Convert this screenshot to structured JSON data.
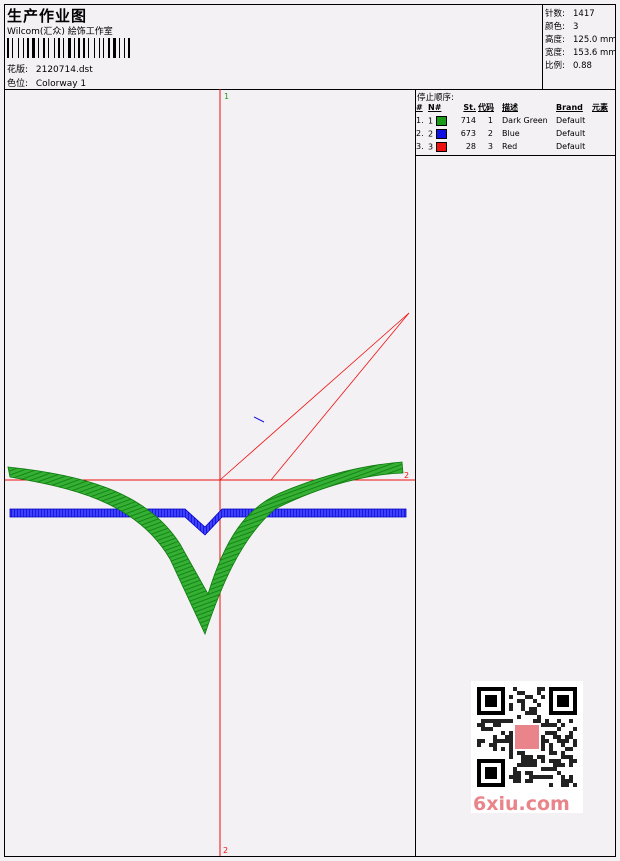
{
  "header": {
    "title": "生产作业图",
    "company": "Wilcom(汇众) 絵饰工作室",
    "design_label": "花版:",
    "design_value": "2120714.dst",
    "colorway_label": "色位:",
    "colorway_value": "Colorway 1"
  },
  "stats": {
    "stitches_label": "针数:",
    "stitches_value": "1417",
    "colors_label": "颜色:",
    "colors_value": "3",
    "height_label": "高度:",
    "height_value": "125.0 mm",
    "width_label": "宽度:",
    "width_value": "153.6 mm",
    "scale_label": "比例:",
    "scale_value": "0.88"
  },
  "stop_sequence": {
    "title": "停止顺序:",
    "headers": [
      "#",
      "N#",
      "St.",
      "代码",
      "描述",
      "Brand",
      "元素"
    ],
    "rows": [
      {
        "idx": "1.",
        "n": "1",
        "color": "#1a9c1a",
        "st": "714",
        "code": "1",
        "desc": "Dark Green",
        "brand": "Default"
      },
      {
        "idx": "2.",
        "n": "2",
        "color": "#1010e0",
        "st": "673",
        "code": "2",
        "desc": "Blue",
        "brand": "Default"
      },
      {
        "idx": "3.",
        "n": "3",
        "color": "#ee1010",
        "st": "28",
        "code": "3",
        "desc": "Red",
        "brand": "Default"
      }
    ]
  },
  "canvas": {
    "axis_top_label": "1",
    "axis_bottom_label": "2",
    "axis_right_label": "2"
  },
  "watermark": {
    "site": "6xiu.com"
  },
  "colors": {
    "green": "#1a9c1a",
    "blue": "#1010e0",
    "red": "#ee1010",
    "axis_green": "#20a020"
  }
}
